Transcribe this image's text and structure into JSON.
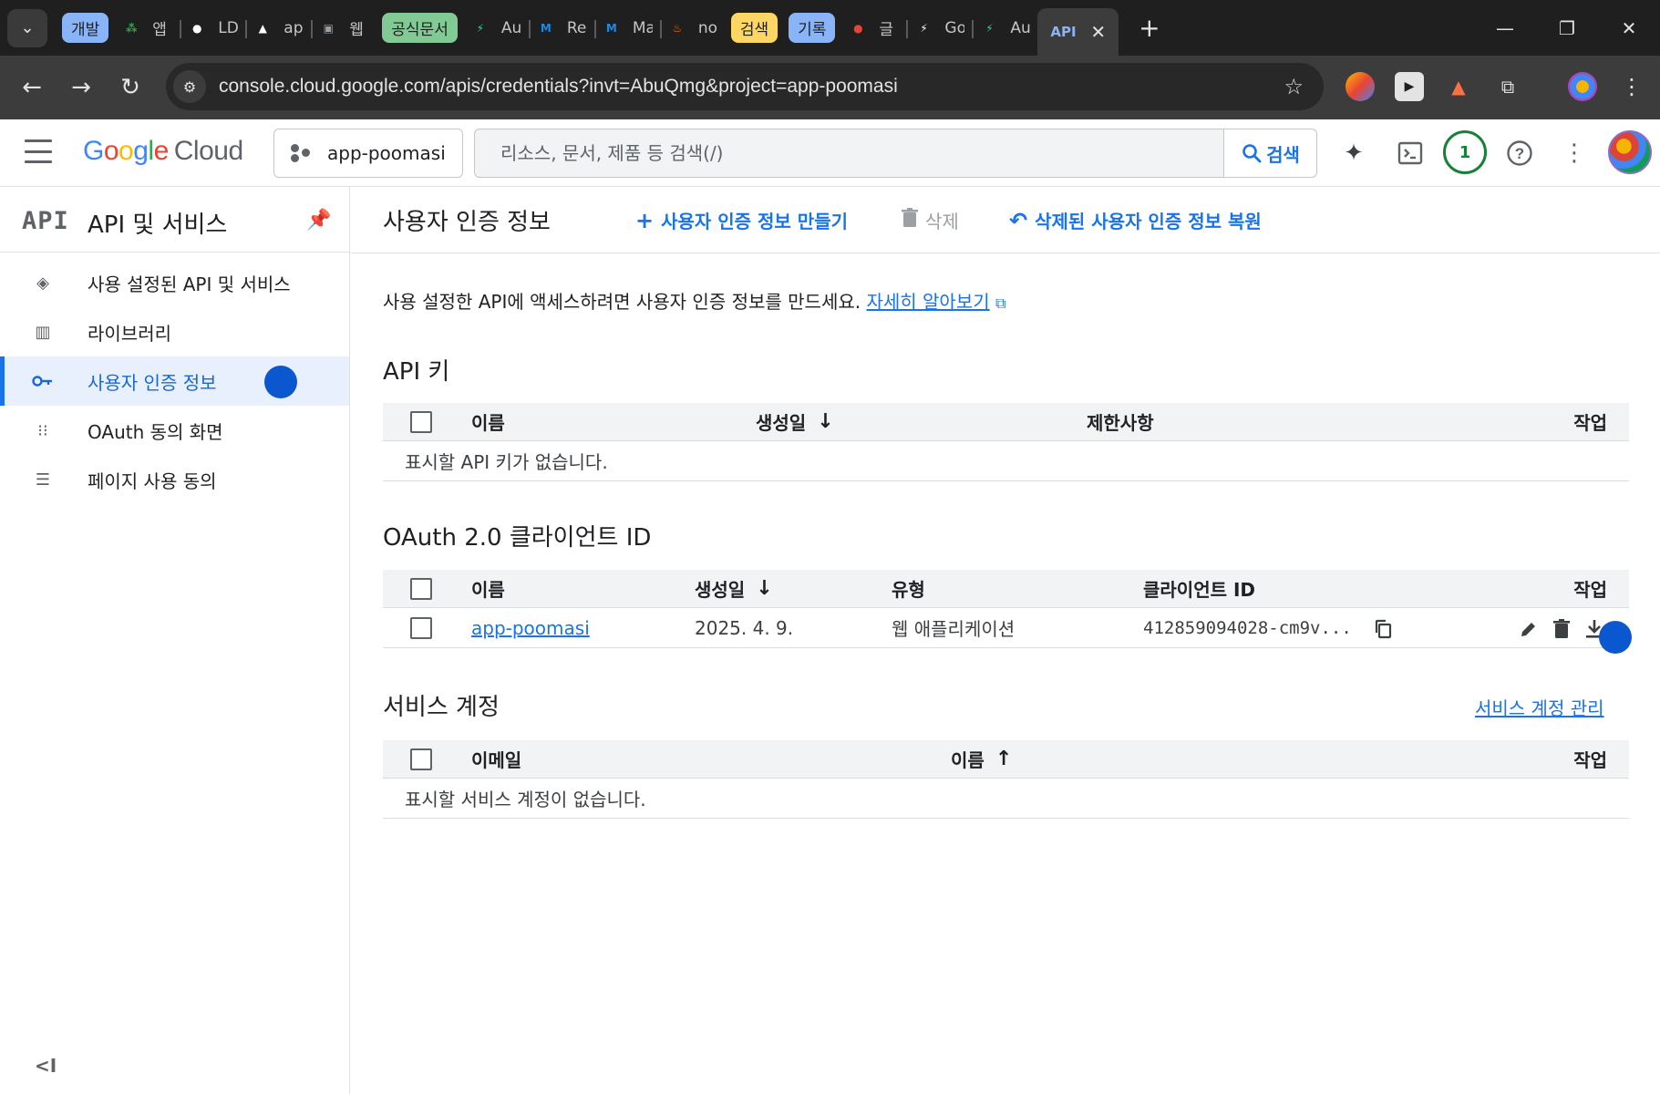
{
  "browser": {
    "tabs": [
      {
        "kind": "group",
        "label": "개발",
        "color": "#8ab4f8"
      },
      {
        "kind": "tab",
        "title": "앱",
        "icon": "apps-icon",
        "fav_color": "#34a853"
      },
      {
        "kind": "tab",
        "title": "LD",
        "icon": "github-icon",
        "fav_color": "#ffffff"
      },
      {
        "kind": "tab",
        "title": "ap",
        "icon": "triangle-icon",
        "fav_color": "#ffffff"
      },
      {
        "kind": "tab",
        "title": "웹",
        "icon": "square-icon",
        "fav_color": "#9aa0a6"
      },
      {
        "kind": "group",
        "label": "공식문서",
        "color": "#81c995"
      },
      {
        "kind": "tab",
        "title": "Au",
        "icon": "bolt-icon",
        "fav_color": "#3ecf8e"
      },
      {
        "kind": "tab",
        "title": "Re",
        "icon": "mui-icon",
        "fav_color": "#1e88e5"
      },
      {
        "kind": "tab",
        "title": "Ma",
        "icon": "mui-icon",
        "fav_color": "#1e88e5"
      },
      {
        "kind": "tab",
        "title": "no",
        "icon": "flame-icon",
        "fav_color": "#ff6d00"
      },
      {
        "kind": "group",
        "label": "검색",
        "color": "#fdd663"
      },
      {
        "kind": "group",
        "label": "기록",
        "color": "#8ab4f8"
      },
      {
        "kind": "tab",
        "title": "글",
        "icon": "red-circle-icon",
        "fav_color": "#ea4335"
      },
      {
        "kind": "tab",
        "title": "Go",
        "icon": "bolt-icon",
        "fav_color": "#ffffff"
      },
      {
        "kind": "tab",
        "title": "Au",
        "icon": "bolt-icon",
        "fav_color": "#3ecf8e"
      }
    ],
    "active_tab": {
      "title": "API"
    },
    "url": "console.cloud.google.com/apis/credentials?invt=AbuQmg&project=app-poomasi"
  },
  "header": {
    "logo_google": "Google",
    "logo_cloud": "Cloud",
    "project": "app-poomasi",
    "search_placeholder": "리소스, 문서, 제품 등 검색(/)",
    "search_button": "검색",
    "notification_count": "1"
  },
  "sidebar": {
    "mark": "API",
    "title": "API 및 서비스",
    "items": [
      {
        "label": "사용 설정된 API 및 서비스",
        "icon": "api-diamond-icon"
      },
      {
        "label": "라이브러리",
        "icon": "library-icon"
      },
      {
        "label": "사용자 인증 정보",
        "icon": "key-icon",
        "active": true
      },
      {
        "label": "OAuth 동의 화면",
        "icon": "oauth-dots-icon"
      },
      {
        "label": "페이지 사용 동의",
        "icon": "settings-list-icon"
      }
    ]
  },
  "main": {
    "title": "사용자 인증 정보",
    "actions": {
      "create": "사용자 인증 정보 만들기",
      "delete": "삭제",
      "restore": "삭제된 사용자 인증 정보 복원"
    },
    "intro_text": "사용 설정한 API에 액세스하려면 사용자 인증 정보를 만드세요.",
    "intro_link": "자세히 알아보기",
    "api_keys": {
      "title": "API 키",
      "columns": {
        "name": "이름",
        "created": "생성일",
        "restrictions": "제한사항",
        "actions": "작업"
      },
      "empty": "표시할 API 키가 없습니다."
    },
    "oauth": {
      "title": "OAuth 2.0 클라이언트 ID",
      "columns": {
        "name": "이름",
        "created": "생성일",
        "type": "유형",
        "client_id": "클라이언트 ID",
        "actions": "작업"
      },
      "rows": [
        {
          "name": "app-poomasi",
          "created": "2025. 4. 9.",
          "type": "웹 애플리케이션",
          "client_id": "412859094028-cm9v..."
        }
      ]
    },
    "service_accounts": {
      "title": "서비스 계정",
      "manage_link": "서비스 계정 관리",
      "columns": {
        "email": "이메일",
        "name": "이름",
        "actions": "작업"
      },
      "empty": "표시할 서비스 계정이 없습니다."
    }
  }
}
